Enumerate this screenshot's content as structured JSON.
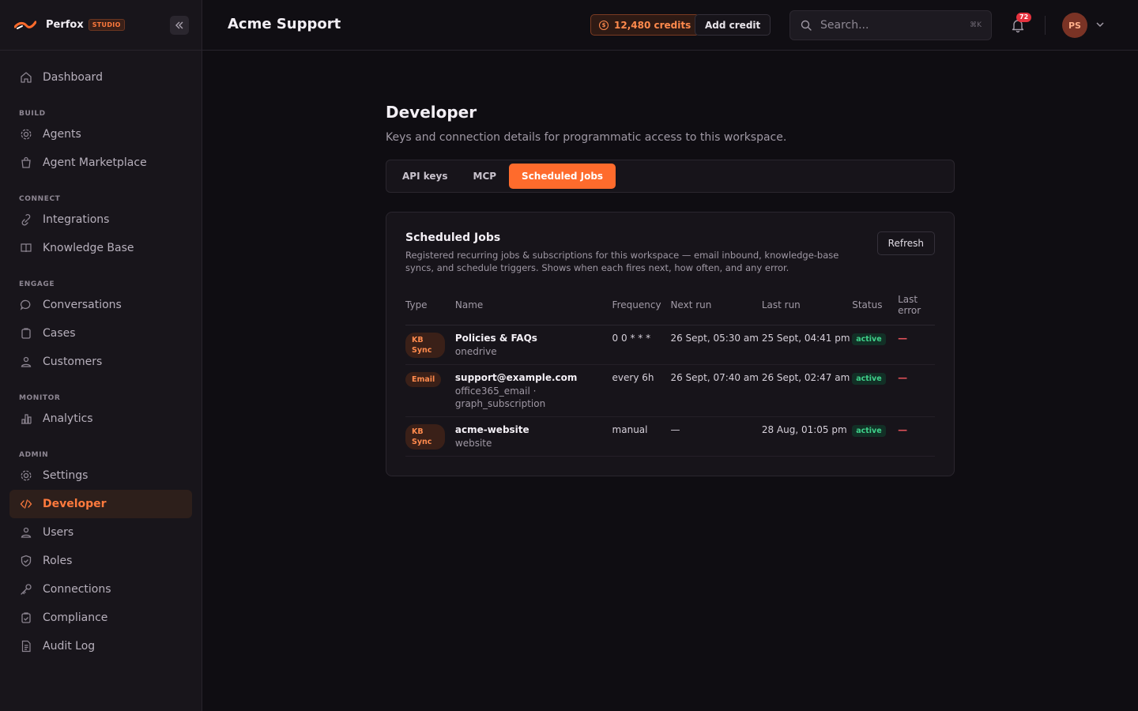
{
  "brand": {
    "name": "Perfox",
    "badge": "STUDIO"
  },
  "sidebar": {
    "top": [
      {
        "label": "Dashboard",
        "icon": "home-icon"
      }
    ],
    "sections": [
      {
        "title": "BUILD",
        "items": [
          {
            "label": "Agents",
            "icon": "gear-icon"
          },
          {
            "label": "Agent Marketplace",
            "icon": "bag-icon"
          }
        ]
      },
      {
        "title": "CONNECT",
        "items": [
          {
            "label": "Integrations",
            "icon": "link-icon"
          },
          {
            "label": "Knowledge Base",
            "icon": "book-icon"
          }
        ]
      },
      {
        "title": "ENGAGE",
        "items": [
          {
            "label": "Conversations",
            "icon": "chat-icon"
          },
          {
            "label": "Cases",
            "icon": "clipboard-icon"
          },
          {
            "label": "Customers",
            "icon": "users-icon"
          }
        ]
      },
      {
        "title": "MONITOR",
        "items": [
          {
            "label": "Analytics",
            "icon": "bar-chart-icon"
          }
        ]
      },
      {
        "title": "ADMIN",
        "items": [
          {
            "label": "Settings",
            "icon": "gear-icon"
          },
          {
            "label": "Developer",
            "icon": "code-icon",
            "active": true
          },
          {
            "label": "Users",
            "icon": "users-icon"
          },
          {
            "label": "Roles",
            "icon": "shield-icon"
          },
          {
            "label": "Connections",
            "icon": "key-icon"
          },
          {
            "label": "Compliance",
            "icon": "clipboard-check-icon"
          },
          {
            "label": "Audit Log",
            "icon": "document-icon"
          }
        ]
      }
    ]
  },
  "header": {
    "title": "Acme Support",
    "credits": "12,480 credits",
    "add_credit": "Add credit",
    "search_placeholder": "Search...",
    "search_shortcut": "⌘K",
    "notifications_count": "72",
    "avatar_initials": "PS"
  },
  "page": {
    "title": "Developer",
    "subtitle": "Keys and connection details for programmatic access to this workspace.",
    "tabs": [
      "API keys",
      "MCP",
      "Scheduled Jobs"
    ],
    "active_tab": "Scheduled Jobs"
  },
  "jobs": {
    "title": "Scheduled Jobs",
    "description": "Registered recurring jobs & subscriptions for this workspace — email inbound, knowledge-base syncs, and schedule triggers. Shows when each fires next, how often, and any error.",
    "refresh_label": "Refresh",
    "columns": [
      "Type",
      "Name",
      "Frequency",
      "Next run",
      "Last run",
      "Status",
      "Last error"
    ],
    "rows": [
      {
        "type": "KB Sync",
        "name": "Policies & FAQs",
        "sub": "onedrive",
        "frequency": "0 0 * * *",
        "next_run": "26 Sept, 05:30 am",
        "last_run": "25 Sept, 04:41 pm",
        "status": "active",
        "last_error": "—"
      },
      {
        "type": "Email",
        "name": "support@example.com",
        "sub": "office365_email · graph_subscription",
        "frequency": "every 6h",
        "next_run": "26 Sept, 07:40 am",
        "last_run": "26 Sept, 02:47 am",
        "status": "active",
        "last_error": "—"
      },
      {
        "type": "KB Sync",
        "name": "acme-website",
        "sub": "website",
        "frequency": "manual",
        "next_run": "—",
        "last_run": "28 Aug, 01:05 pm",
        "status": "active",
        "last_error": "—"
      }
    ]
  },
  "colors": {
    "accent": "#ff6b2c",
    "status_active": "#3fd18a",
    "error": "#e2525a"
  }
}
